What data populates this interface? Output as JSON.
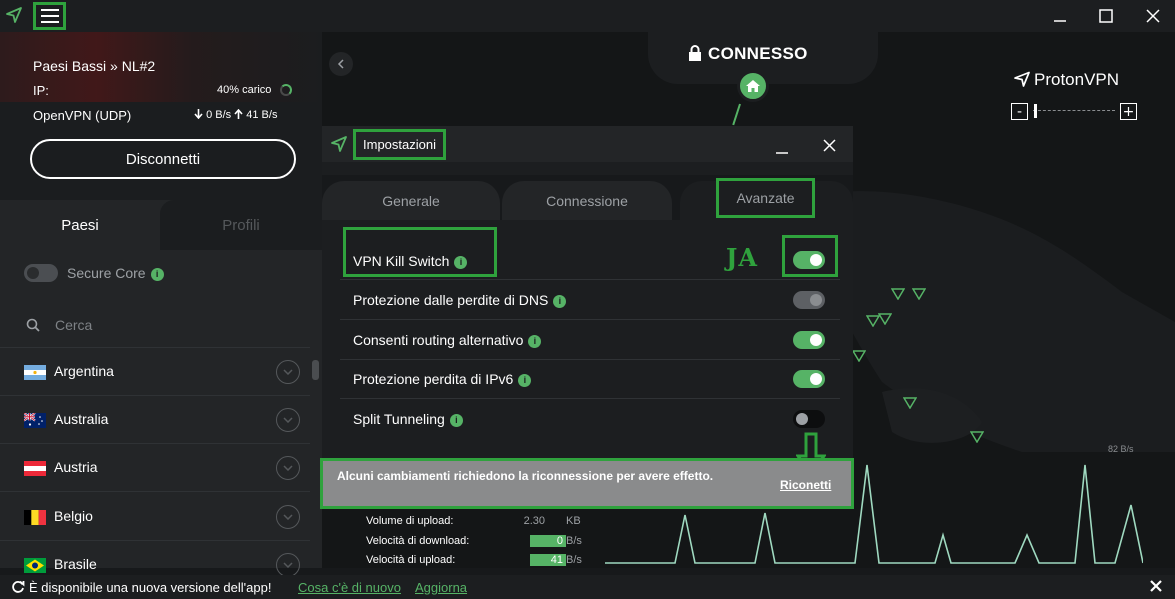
{
  "app": {
    "name": "ProtonVPN"
  },
  "connection": {
    "server": "Paesi Bassi » NL#2",
    "ip_label": "IP:",
    "load": "40% carico",
    "protocol": "OpenVPN (UDP)",
    "speed": "0 B/s   41 B/s",
    "disconnect_label": "Disconnetti"
  },
  "sidebar": {
    "tabs": [
      "Paesi",
      "Profili"
    ],
    "secure_core_label": "Secure Core",
    "search_placeholder": "Cerca",
    "countries": [
      "Argentina",
      "Australia",
      "Austria",
      "Belgio",
      "Brasile"
    ]
  },
  "map": {
    "status": "CONNESSO",
    "brand": "ProtonVPN",
    "zoom_minus": "-",
    "zoom_plus": "+",
    "graph_max_label": "82  B/s"
  },
  "stats": [
    {
      "label": "Volume di upload:",
      "value": "2.30",
      "unit": "KB",
      "highlight": false
    },
    {
      "label": "Velocità di download:",
      "value": "0",
      "unit": "B/s",
      "highlight": true
    },
    {
      "label": "Velocità di upload:",
      "value": "41",
      "unit": "B/s",
      "highlight": true
    }
  ],
  "settings": {
    "title": "Impostazioni",
    "tabs": [
      "Generale",
      "Connessione",
      "Avanzate"
    ],
    "active_tab": "Avanzate",
    "options": [
      {
        "label": "VPN Kill Switch",
        "state": "on"
      },
      {
        "label": "Protezione dalle perdite di DNS",
        "state": "on-disabled"
      },
      {
        "label": "Consenti routing alternativo",
        "state": "on"
      },
      {
        "label": "Protezione perdita di IPv6",
        "state": "on"
      },
      {
        "label": "Split Tunneling",
        "state": "off"
      }
    ],
    "annotation": "JA"
  },
  "banner": {
    "text": "Alcuni cambiamenti richiedono la riconnessione per avere effetto.",
    "link": "Riconetti"
  },
  "update_bar": {
    "text": "È disponibile una nuova versione dell'app!",
    "whats_new": "Cosa c'è di nuovo",
    "update": "Aggiorna"
  },
  "colors": {
    "accent": "#56b366",
    "highlight_frame": "#2fa23d",
    "background": "#17191b"
  }
}
